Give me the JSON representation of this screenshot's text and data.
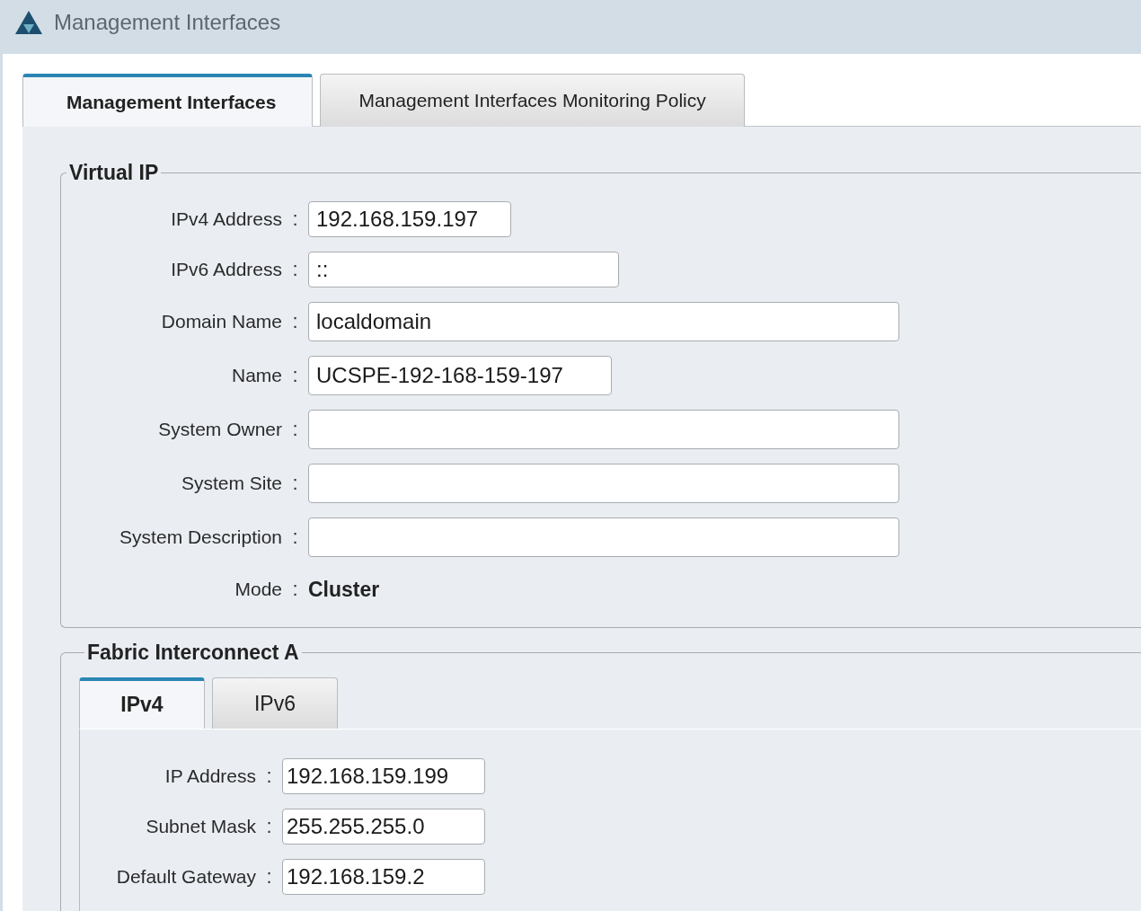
{
  "window": {
    "title": "Management Interfaces"
  },
  "tabs": [
    {
      "label": "Management Interfaces",
      "selected": true
    },
    {
      "label": "Management Interfaces Monitoring Policy",
      "selected": false
    }
  ],
  "virtual_ip": {
    "legend": "Virtual IP",
    "rows": [
      {
        "kind": "field",
        "label": "IPv4 Address",
        "colon": ":",
        "value": "192.168.159.197"
      },
      {
        "kind": "field",
        "label": "IPv6 Address",
        "colon": ":",
        "value": "::"
      },
      {
        "kind": "field",
        "label": "Domain Name",
        "colon": ":",
        "value": "localdomain"
      },
      {
        "kind": "field",
        "label": "Name",
        "colon": ":",
        "value": "UCSPE-192-168-159-197"
      },
      {
        "kind": "field",
        "label": "System Owner",
        "colon": ":"
      },
      {
        "kind": "field",
        "label": "System Site",
        "colon": ":"
      },
      {
        "kind": "field",
        "label": "System Description",
        "colon": ":"
      },
      {
        "kind": "text",
        "label": "Mode",
        "colon": ":",
        "value": "Cluster"
      }
    ]
  },
  "fabric_interconnect_a": {
    "legend": "Fabric Interconnect A",
    "tabs": [
      {
        "label": "IPv4",
        "selected": true
      },
      {
        "label": "IPv6",
        "selected": false
      }
    ],
    "rows": [
      {
        "kind": "field",
        "label": "IP Address",
        "colon": ":",
        "value": "192.168.159.199"
      },
      {
        "kind": "field",
        "label": "Subnet Mask",
        "colon": ":",
        "value": "255.255.255.0"
      },
      {
        "kind": "field",
        "label": "Default Gateway",
        "colon": ":",
        "value": "192.168.159.2"
      }
    ]
  }
}
